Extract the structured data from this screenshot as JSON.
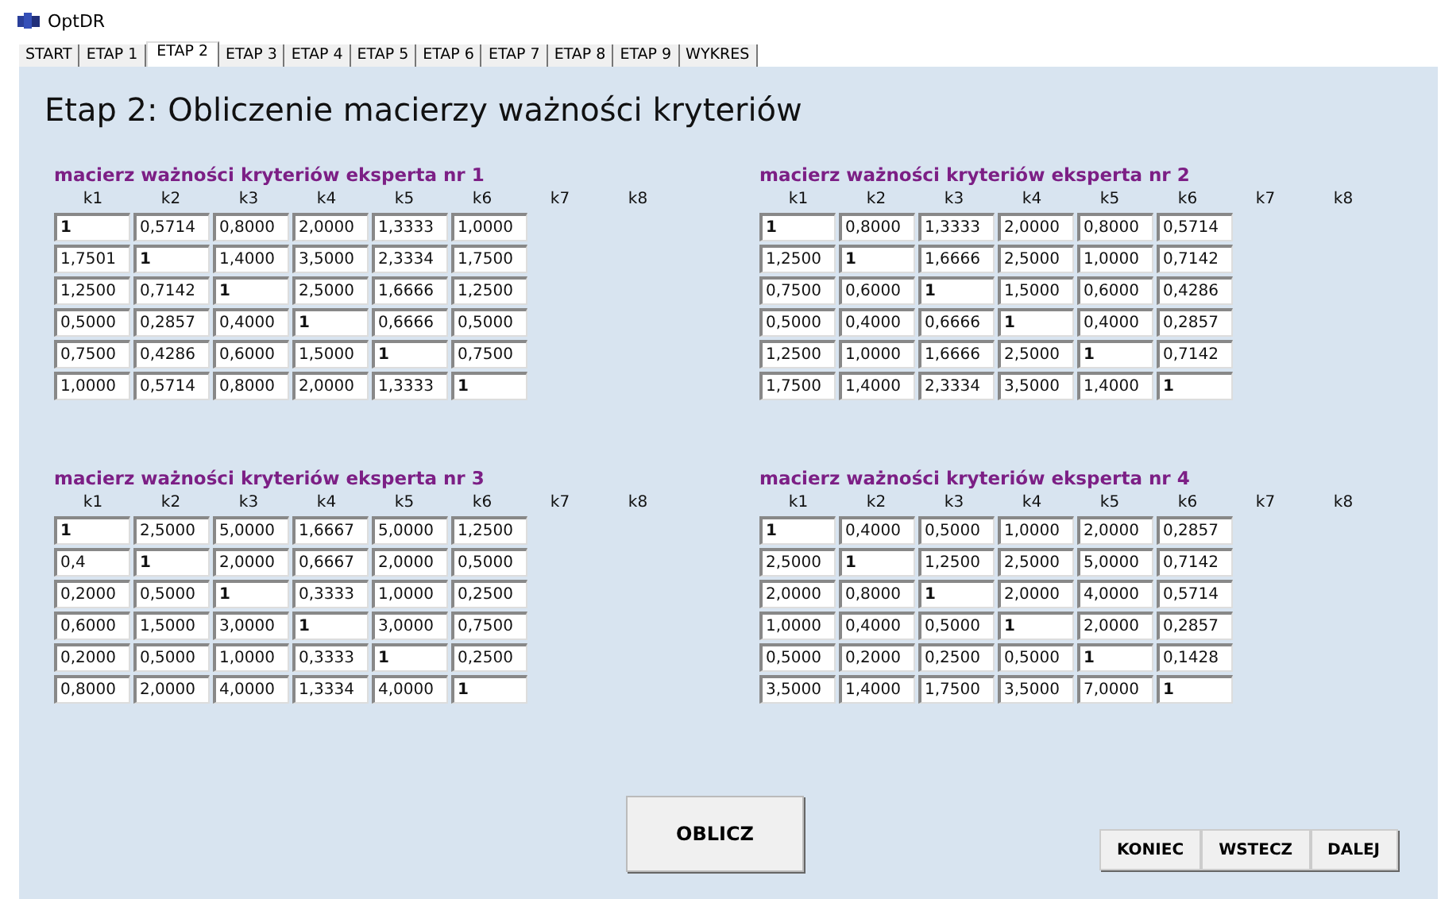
{
  "window": {
    "title": "OptDR"
  },
  "tabs": [
    {
      "label": "START",
      "selected": false
    },
    {
      "label": "ETAP 1",
      "selected": false
    },
    {
      "label": "ETAP 2",
      "selected": true
    },
    {
      "label": "ETAP 3",
      "selected": false
    },
    {
      "label": "ETAP 4",
      "selected": false
    },
    {
      "label": "ETAP 5",
      "selected": false
    },
    {
      "label": "ETAP 6",
      "selected": false
    },
    {
      "label": "ETAP 7",
      "selected": false
    },
    {
      "label": "ETAP 8",
      "selected": false
    },
    {
      "label": "ETAP 9",
      "selected": false
    },
    {
      "label": "WYKRES",
      "selected": false
    }
  ],
  "heading": "Etap 2: Obliczenie macierzy ważności kryteriów",
  "matrices": [
    {
      "title": "macierz ważności kryteriów eksperta nr 1",
      "columns": [
        "k1",
        "k2",
        "k3",
        "k4",
        "k5",
        "k6",
        "k7",
        "k8"
      ],
      "rows": [
        [
          "1",
          "0,5714",
          "0,8000",
          "2,0000",
          "1,3333",
          "1,0000"
        ],
        [
          "1,7501",
          "1",
          "1,4000",
          "3,5000",
          "2,3334",
          "1,7500"
        ],
        [
          "1,2500",
          "0,7142",
          "1",
          "2,5000",
          "1,6666",
          "1,2500"
        ],
        [
          "0,5000",
          "0,2857",
          "0,4000",
          "1",
          "0,6666",
          "0,5000"
        ],
        [
          "0,7500",
          "0,4286",
          "0,6000",
          "1,5000",
          "1",
          "0,7500"
        ],
        [
          "1,0000",
          "0,5714",
          "0,8000",
          "2,0000",
          "1,3333",
          "1"
        ]
      ]
    },
    {
      "title": "macierz ważności kryteriów eksperta nr 2",
      "columns": [
        "k1",
        "k2",
        "k3",
        "k4",
        "k5",
        "k6",
        "k7",
        "k8"
      ],
      "rows": [
        [
          "1",
          "0,8000",
          "1,3333",
          "2,0000",
          "0,8000",
          "0,5714"
        ],
        [
          "1,2500",
          "1",
          "1,6666",
          "2,5000",
          "1,0000",
          "0,7142"
        ],
        [
          "0,7500",
          "0,6000",
          "1",
          "1,5000",
          "0,6000",
          "0,4286"
        ],
        [
          "0,5000",
          "0,4000",
          "0,6666",
          "1",
          "0,4000",
          "0,2857"
        ],
        [
          "1,2500",
          "1,0000",
          "1,6666",
          "2,5000",
          "1",
          "0,7142"
        ],
        [
          "1,7500",
          "1,4000",
          "2,3334",
          "3,5000",
          "1,4000",
          "1"
        ]
      ]
    },
    {
      "title": "macierz ważności kryteriów eksperta nr 3",
      "columns": [
        "k1",
        "k2",
        "k3",
        "k4",
        "k5",
        "k6",
        "k7",
        "k8"
      ],
      "rows": [
        [
          "1",
          "2,5000",
          "5,0000",
          "1,6667",
          "5,0000",
          "1,2500"
        ],
        [
          "0,4",
          "1",
          "2,0000",
          "0,6667",
          "2,0000",
          "0,5000"
        ],
        [
          "0,2000",
          "0,5000",
          "1",
          "0,3333",
          "1,0000",
          "0,2500"
        ],
        [
          "0,6000",
          "1,5000",
          "3,0000",
          "1",
          "3,0000",
          "0,7500"
        ],
        [
          "0,2000",
          "0,5000",
          "1,0000",
          "0,3333",
          "1",
          "0,2500"
        ],
        [
          "0,8000",
          "2,0000",
          "4,0000",
          "1,3334",
          "4,0000",
          "1"
        ]
      ]
    },
    {
      "title": "macierz ważności kryteriów eksperta nr 4",
      "columns": [
        "k1",
        "k2",
        "k3",
        "k4",
        "k5",
        "k6",
        "k7",
        "k8"
      ],
      "rows": [
        [
          "1",
          "0,4000",
          "0,5000",
          "1,0000",
          "2,0000",
          "0,2857"
        ],
        [
          "2,5000",
          "1",
          "1,2500",
          "2,5000",
          "5,0000",
          "0,7142"
        ],
        [
          "2,0000",
          "0,8000",
          "1",
          "2,0000",
          "4,0000",
          "0,5714"
        ],
        [
          "1,0000",
          "0,4000",
          "0,5000",
          "1",
          "2,0000",
          "0,2857"
        ],
        [
          "0,5000",
          "0,2000",
          "0,2500",
          "0,5000",
          "1",
          "0,1428"
        ],
        [
          "3,5000",
          "1,4000",
          "1,7500",
          "3,5000",
          "7,0000",
          "1"
        ]
      ]
    }
  ],
  "calculate_button": "OBLICZ",
  "nav_buttons": [
    "KONIEC",
    "WSTECZ",
    "DALEJ"
  ]
}
